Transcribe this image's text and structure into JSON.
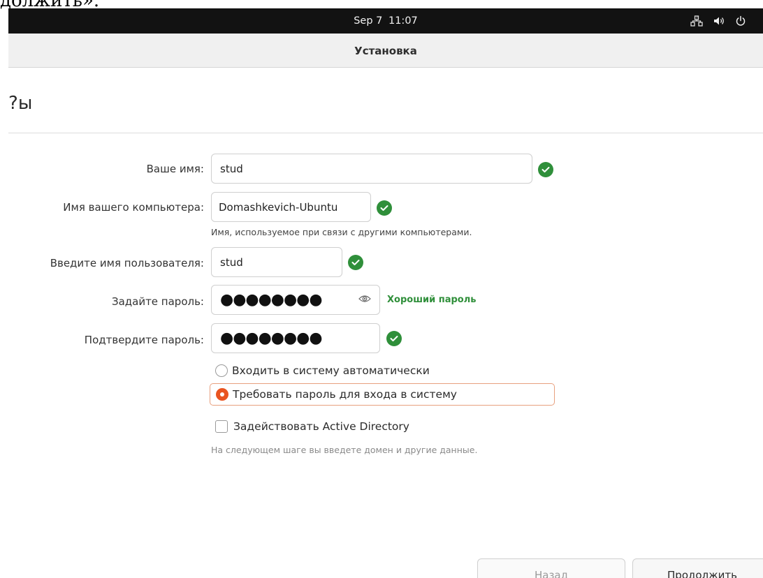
{
  "document_fragment": "должить».",
  "topbar": {
    "date": "Sep 7",
    "time": "11:07",
    "icons": [
      "network-icon",
      "volume-icon",
      "power-icon"
    ]
  },
  "window": {
    "title": "Установка"
  },
  "page": {
    "heading": "ы?"
  },
  "form": {
    "name": {
      "label": "Ваше имя:",
      "value": "stud",
      "valid": true
    },
    "computer": {
      "label": "Имя вашего компьютера:",
      "value": "Domashkevich-Ubuntu",
      "hint": "Имя, используемое при связи с другими компьютерами.",
      "valid": true
    },
    "username": {
      "label": "Введите имя пользователя:",
      "value": "stud",
      "valid": true
    },
    "password": {
      "label": "Задайте пароль:",
      "value": "●●●●●●●●",
      "strength": "Хороший пароль"
    },
    "confirm": {
      "label": "Подтвердите пароль:",
      "value": "●●●●●●●●",
      "valid": true
    }
  },
  "login_options": {
    "auto": {
      "label": "Входить в систему автоматически",
      "selected": false
    },
    "require": {
      "label": "Требовать пароль для входа в систему",
      "selected": true
    }
  },
  "active_directory": {
    "label": "Задействовать Active Directory",
    "checked": false,
    "hint": "На следующем шаге вы введете домен и другие данные."
  },
  "buttons": {
    "back": "Назад",
    "next": "Продолжить"
  },
  "colors": {
    "accent": "#e95420",
    "valid": "#2f8f3a",
    "topbar": "#121212"
  }
}
